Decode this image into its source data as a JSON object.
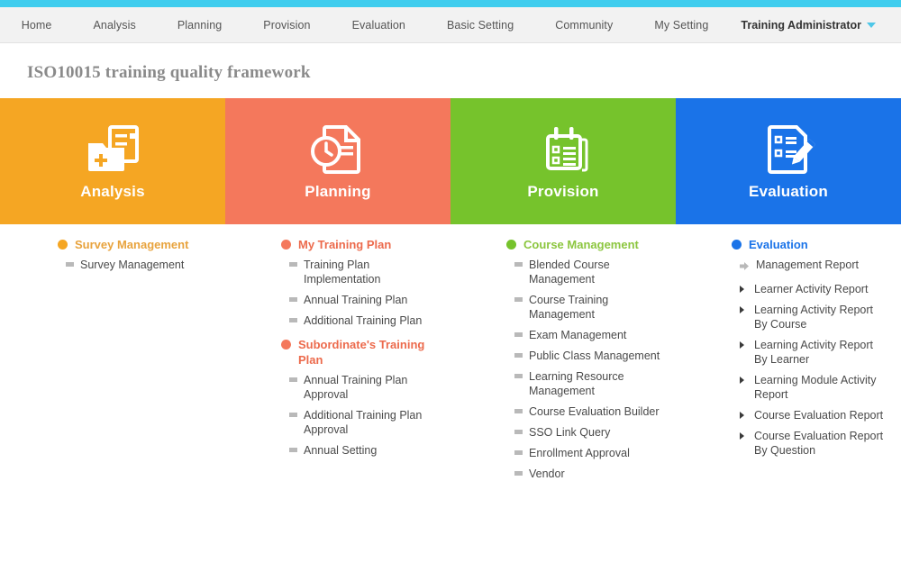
{
  "theme": {
    "top_strip_color": "#3fcdee",
    "navbar_bg": "#f2f2f2",
    "accent_orange": "#f5a623",
    "accent_salmon": "#f4785c",
    "accent_green": "#76c32c",
    "accent_blue": "#1a73e8"
  },
  "navbar": {
    "items": [
      {
        "label": "Home"
      },
      {
        "label": "Analysis"
      },
      {
        "label": "Planning"
      },
      {
        "label": "Provision"
      },
      {
        "label": "Evaluation"
      },
      {
        "label": "Basic Setting"
      },
      {
        "label": "Community"
      },
      {
        "label": "My Setting"
      }
    ],
    "user": {
      "label": "Training Administrator",
      "caret_icon": "chevron-down-icon"
    }
  },
  "page": {
    "title": "ISO10015 training quality framework"
  },
  "cards": [
    {
      "label": "Analysis",
      "color": "#f5a623",
      "icon": "folder-add-document-icon"
    },
    {
      "label": "Planning",
      "color": "#f4785c",
      "icon": "document-clock-icon"
    },
    {
      "label": "Provision",
      "color": "#76c32c",
      "icon": "calendar-checklist-icon"
    },
    {
      "label": "Evaluation",
      "color": "#1a73e8",
      "icon": "document-pencil-icon"
    }
  ],
  "columns": [
    {
      "key": "analysis",
      "groups": [
        {
          "heading": "Survey Management",
          "dot_color": "#f5a623",
          "heading_color": "#e8a33d",
          "marker": "square",
          "items": [
            {
              "label": "Survey Management"
            }
          ]
        }
      ]
    },
    {
      "key": "planning",
      "groups": [
        {
          "heading": "My Training Plan",
          "dot_color": "#f4785c",
          "heading_color": "#ec6a4c",
          "marker": "square",
          "items": [
            {
              "label": "Training Plan Implementation"
            },
            {
              "label": "Annual Training Plan"
            },
            {
              "label": "Additional Training Plan"
            }
          ]
        },
        {
          "heading": "Subordinate's Training Plan",
          "dot_color": "#f4785c",
          "heading_color": "#ec6a4c",
          "marker": "square",
          "items": [
            {
              "label": "Annual Training Plan Approval"
            },
            {
              "label": "Additional Training Plan Approval"
            },
            {
              "label": "Annual Setting"
            }
          ]
        }
      ]
    },
    {
      "key": "provision",
      "groups": [
        {
          "heading": "Course Management",
          "dot_color": "#76c32c",
          "heading_color": "#8cc63f",
          "marker": "square",
          "items": [
            {
              "label": "Blended Course Management"
            },
            {
              "label": "Course Training Management"
            },
            {
              "label": "Exam Management"
            },
            {
              "label": "Public Class Management"
            },
            {
              "label": "Learning Resource Management"
            },
            {
              "label": "Course Evaluation Builder"
            },
            {
              "label": "SSO Link Query"
            },
            {
              "label": "Enrollment Approval"
            },
            {
              "label": "Vendor"
            }
          ]
        }
      ]
    },
    {
      "key": "evaluation",
      "groups": [
        {
          "heading": "Evaluation",
          "dot_color": "#1a73e8",
          "heading_color": "#1a73e8",
          "marker": "tri",
          "items": [
            {
              "label": "Management Report",
              "marker": "arrow"
            },
            {
              "label": "Learner Activity Report"
            },
            {
              "label": "Learning Activity Report By Course"
            },
            {
              "label": "Learning Activity Report By Learner"
            },
            {
              "label": "Learning Module Activity Report"
            },
            {
              "label": "Course Evaluation Report"
            },
            {
              "label": "Course Evaluation Report By Question"
            }
          ]
        }
      ]
    }
  ]
}
